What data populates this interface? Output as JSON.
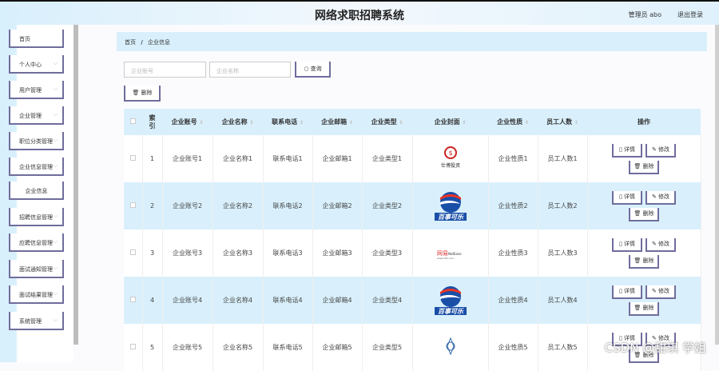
{
  "header": {
    "title": "网络求职招聘系统",
    "user": "管理员 abo",
    "logout": "退出登录"
  },
  "sidebar": {
    "items": [
      {
        "label": "首页",
        "chevron": false
      },
      {
        "label": "个人中心",
        "chevron": true
      },
      {
        "label": "用户管理",
        "chevron": true
      },
      {
        "label": "企业管理",
        "chevron": true
      },
      {
        "label": "职位分类管理",
        "chevron": true
      },
      {
        "label": "企业信息管理",
        "chevron": true
      },
      {
        "label": "企业信息",
        "chevron": false,
        "sub": true
      },
      {
        "label": "招聘信息管理",
        "chevron": true
      },
      {
        "label": "应聘信息管理",
        "chevron": true
      },
      {
        "label": "面试通知管理",
        "chevron": true
      },
      {
        "label": "面试结果管理",
        "chevron": true
      },
      {
        "label": "系统管理",
        "chevron": true
      }
    ]
  },
  "breadcrumb": {
    "home": "首页",
    "sep": "/",
    "current": "企业信息"
  },
  "search": {
    "account_placeholder": "企业账号",
    "name_placeholder": "企业名称",
    "query_label": "查询",
    "delete_label": "删除"
  },
  "table": {
    "headers": [
      "索引",
      "企业账号",
      "企业名称",
      "联系电话",
      "企业邮箱",
      "企业类型",
      "企业封面",
      "企业性质",
      "员工人数",
      "操作"
    ],
    "actions": {
      "detail": "详情",
      "edit": "修改",
      "delete": "删除"
    },
    "rows": [
      {
        "index": "1",
        "account": "企业账号1",
        "name": "企业名称1",
        "phone": "联系电话1",
        "email": "企业邮箱1",
        "type": "企业类型1",
        "cover": "仕博投资",
        "nature": "企业性质1",
        "count": "员工人数1"
      },
      {
        "index": "2",
        "account": "企业账号2",
        "name": "企业名称2",
        "phone": "联系电话2",
        "email": "企业邮箱2",
        "type": "企业类型2",
        "cover": "百事可乐",
        "nature": "企业性质2",
        "count": "员工人数2"
      },
      {
        "index": "3",
        "account": "企业账号3",
        "name": "企业名称3",
        "phone": "联系电话3",
        "email": "企业邮箱3",
        "type": "企业类型3",
        "cover": "网易",
        "nature": "企业性质3",
        "count": "员工人数3"
      },
      {
        "index": "4",
        "account": "企业账号4",
        "name": "企业名称4",
        "phone": "联系电话4",
        "email": "企业邮箱4",
        "type": "企业类型4",
        "cover": "百事可乐",
        "nature": "企业性质4",
        "count": "员工人数4"
      },
      {
        "index": "5",
        "account": "企业账号5",
        "name": "企业名称5",
        "phone": "联系电话5",
        "email": "企业邮箱5",
        "type": "企业类型5",
        "cover": "",
        "nature": "企业性质5",
        "count": "员工人数5"
      }
    ]
  },
  "watermark": "CSDN @甜琪 学姐"
}
